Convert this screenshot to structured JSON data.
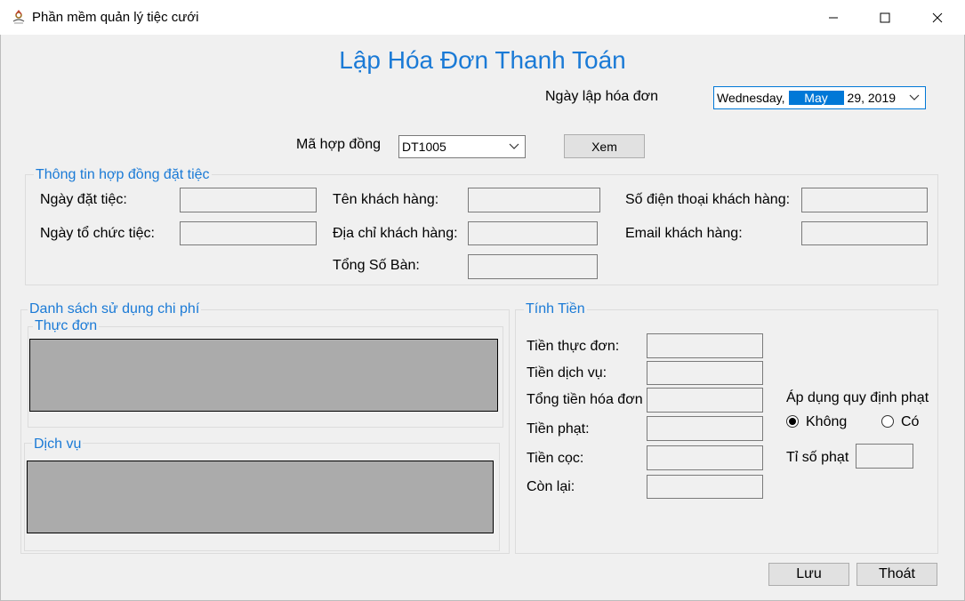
{
  "window": {
    "title": "Phần mềm quản lý tiệc cưới",
    "icon": "wedding-app-icon",
    "controls": [
      "minimize-icon",
      "maximize-icon",
      "close-icon"
    ]
  },
  "heading": "Lập Hóa Đơn Thanh Toán",
  "invoice_date": {
    "label": "Ngày lập hóa đơn",
    "weekday": "Wednesday,",
    "month": "May",
    "day_year": "29, 2019"
  },
  "contract": {
    "label": "Mã hợp đồng",
    "selected": "DT1005",
    "view_button": "Xem"
  },
  "contract_info": {
    "legend": "Thông tin hợp đồng đặt tiệc",
    "booking_date_label": "Ngày đặt tiệc:",
    "party_date_label": "Ngày tổ chức tiệc:",
    "customer_name_label": "Tên khách hàng:",
    "customer_address_label": "Địa chỉ khách hàng:",
    "table_count_label": "Tổng Số Bàn:",
    "customer_phone_label": "Số điện thoại khách hàng:",
    "customer_email_label": "Email khách hàng:"
  },
  "expenses": {
    "legend": "Danh sách sử dụng chi phí",
    "menu_legend": "Thực đơn",
    "services_legend": "Dịch vụ"
  },
  "billing": {
    "legend": "Tính Tiền",
    "menu_cost_label": "Tiền thực đơn:",
    "service_cost_label": "Tiền dịch vụ:",
    "invoice_total_label": "Tổng tiền hóa đơn",
    "penalty_label": "Tiền phạt:",
    "deposit_label": "Tiền cọc:",
    "remaining_label": "Còn lại:",
    "penalty_rule_label": "Áp dụng quy định phạt",
    "option_no": "Không",
    "option_yes": "Có",
    "selected_option": "Không",
    "penalty_ratio_label": "Tỉ số phạt"
  },
  "buttons": {
    "save": "Lưu",
    "exit": "Thoát"
  },
  "colors": {
    "accent": "#1a7ad6",
    "grid_background": "#ababab",
    "date_highlight": "#0078d7"
  }
}
